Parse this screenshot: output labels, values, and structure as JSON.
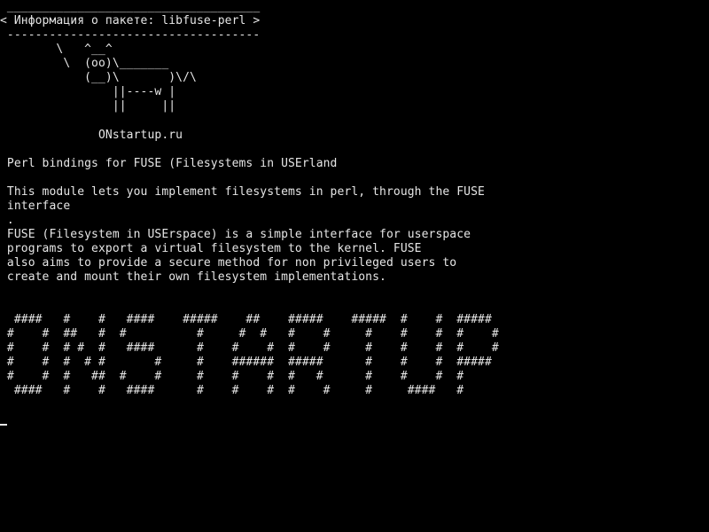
{
  "terminal": {
    "bubble": {
      "top_border": " ____________________________________",
      "text": "< Информация о пакете: libfuse-perl >",
      "bottom_border": " ------------------------------------"
    },
    "cow": [
      "        \\   ^__^",
      "         \\  (oo)\\_______",
      "            (__)\\       )\\/\\",
      "                ||----w |",
      "                ||     ||"
    ],
    "site": "              ONstartup.ru",
    "package_summary": " Perl bindings for FUSE (Filesystems in USErland",
    "description": [
      " This module lets you implement filesystems in perl, through the FUSE",
      " interface",
      " .",
      " FUSE (Filesystem in USErspace) is a simple interface for userspace",
      " programs to export a virtual filesystem to the kernel. FUSE",
      " also aims to provide a secure method for non privileged users to",
      " create and mount their own filesystem implementations."
    ],
    "banner": [
      "  ####   #    #   ####    #####    ##    #####    #####  #    #  #####",
      " #    #  ##   #  #          #     #  #   #    #     #    #    #  #    #",
      " #    #  # #  #   ####      #    #    #  #    #     #    #    #  #    #",
      " #    #  #  # #       #     #    ######  #####      #    #    #  #####",
      " #    #  #   ##  #    #     #    #    #  #   #      #    #    #  #",
      "  ####   #    #   ####      #    #    #  #    #     #     ####   #"
    ]
  }
}
